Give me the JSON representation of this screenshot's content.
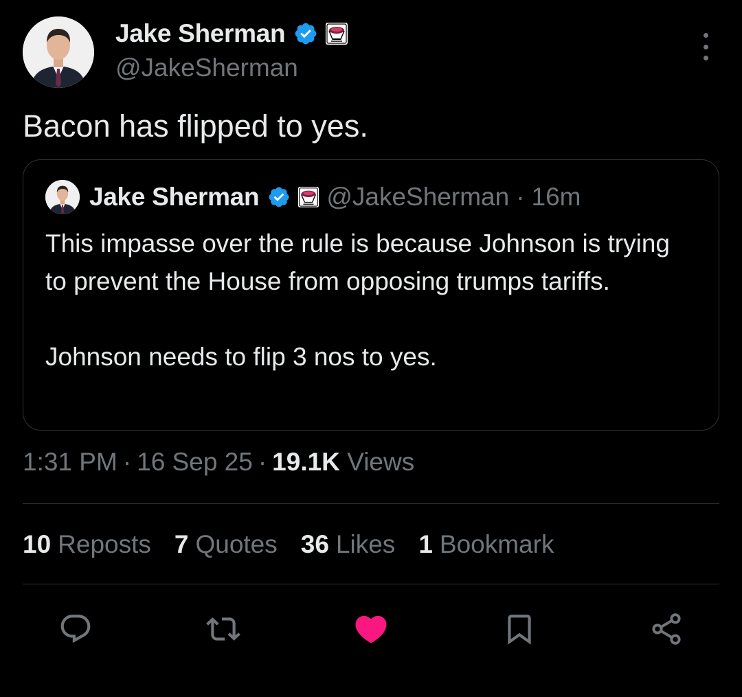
{
  "author": {
    "display_name": "Jake Sherman",
    "handle": "@JakeSherman",
    "verified_icon": "verified-badge-icon",
    "affiliation_icon": "affiliation-badge-icon"
  },
  "tweet": {
    "text": "Bacon has flipped to yes."
  },
  "quote": {
    "display_name": "Jake Sherman",
    "handle": "@JakeSherman",
    "separator": "·",
    "time": "16m",
    "paragraphs": [
      "This impasse over the rule is because Johnson is trying to prevent the House from opposing trumps tariffs.",
      "Johnson needs to flip 3 nos to yes."
    ]
  },
  "meta": {
    "time": "1:31 PM",
    "separator": "·",
    "date": "16 Sep 25",
    "views_count": "19.1K",
    "views_label": "Views"
  },
  "stats": [
    {
      "count": "10",
      "label": "Reposts"
    },
    {
      "count": "7",
      "label": "Quotes"
    },
    {
      "count": "36",
      "label": "Likes"
    },
    {
      "count": "1",
      "label": "Bookmark"
    }
  ],
  "actions": {
    "reply_icon": "reply-icon",
    "repost_icon": "repost-icon",
    "like_icon": "heart-icon",
    "bookmark_icon": "bookmark-icon",
    "share_icon": "share-icon",
    "like_active": true
  },
  "colors": {
    "background": "#000000",
    "text_primary": "#e7e9ea",
    "text_secondary": "#71767b",
    "border": "#2f3336",
    "verified_blue": "#1d9bf0",
    "like_pink": "#f91880"
  }
}
